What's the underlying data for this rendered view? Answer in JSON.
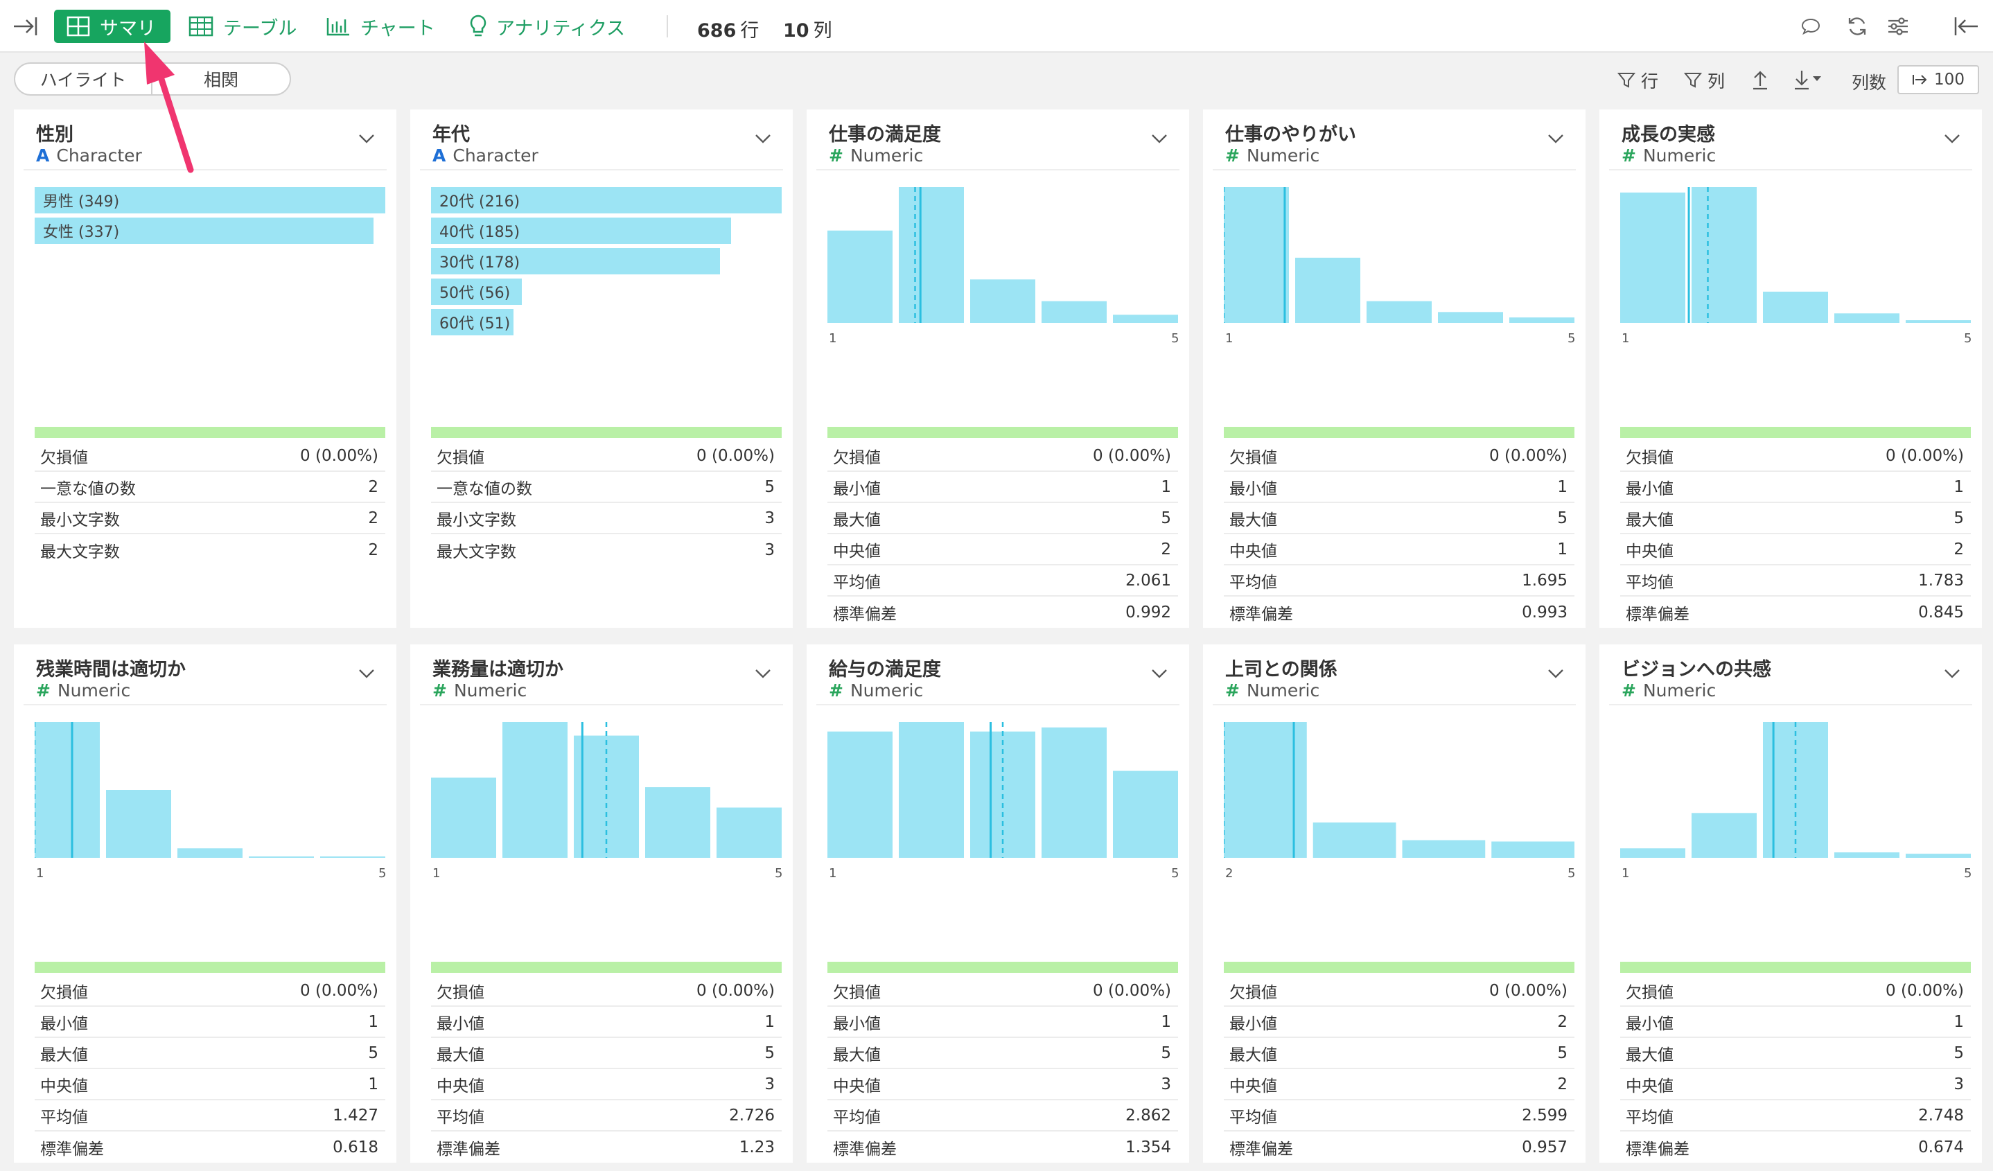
{
  "toolbar": {
    "tabs": [
      {
        "label": "サマリ",
        "icon": "grid-icon"
      },
      {
        "label": "テーブル",
        "icon": "table-icon"
      },
      {
        "label": "チャート",
        "icon": "bar-chart-icon"
      },
      {
        "label": "アナリティクス",
        "icon": "lightbulb-icon"
      }
    ],
    "rows_count": "686",
    "rows_unit": "行",
    "cols_count": "10",
    "cols_unit": "列"
  },
  "subbar": {
    "segments": [
      "ハイライト",
      "相関"
    ],
    "filter_row": "行",
    "filter_col": "列",
    "col_count_label": "列数",
    "col_count_value": "100"
  },
  "columns": [
    {
      "title": "性別",
      "type": "Character",
      "kind": "char",
      "bars": [
        {
          "label": "男性 (349)",
          "value": 349
        },
        {
          "label": "女性 (337)",
          "value": 337
        }
      ],
      "stats": [
        {
          "label": "欠損値",
          "value": "0 (0.00%)"
        },
        {
          "label": "一意な値の数",
          "value": "2"
        },
        {
          "label": "最小文字数",
          "value": "2"
        },
        {
          "label": "最大文字数",
          "value": "2"
        }
      ]
    },
    {
      "title": "年代",
      "type": "Character",
      "kind": "char",
      "bars": [
        {
          "label": "20代 (216)",
          "value": 216
        },
        {
          "label": "40代 (185)",
          "value": 185
        },
        {
          "label": "30代 (178)",
          "value": 178
        },
        {
          "label": "50代 (56)",
          "value": 56
        },
        {
          "label": "60代 (51)",
          "value": 51
        }
      ],
      "stats": [
        {
          "label": "欠損値",
          "value": "0 (0.00%)"
        },
        {
          "label": "一意な値の数",
          "value": "5"
        },
        {
          "label": "最小文字数",
          "value": "3"
        },
        {
          "label": "最大文字数",
          "value": "3"
        }
      ]
    },
    {
      "title": "仕事の満足度",
      "type": "Numeric",
      "kind": "num",
      "hist": [
        0.68,
        1.0,
        0.32,
        0.16,
        0.06
      ],
      "axis_min": "1",
      "axis_max": "5",
      "mean": 2.061,
      "median": 2,
      "stats": [
        {
          "label": "欠損値",
          "value": "0 (0.00%)"
        },
        {
          "label": "最小値",
          "value": "1"
        },
        {
          "label": "最大値",
          "value": "5"
        },
        {
          "label": "中央値",
          "value": "2"
        },
        {
          "label": "平均値",
          "value": "2.061"
        },
        {
          "label": "標準偏差",
          "value": "0.992"
        }
      ]
    },
    {
      "title": "仕事のやりがい",
      "type": "Numeric",
      "kind": "num",
      "hist": [
        1.0,
        0.48,
        0.16,
        0.08,
        0.04
      ],
      "axis_min": "1",
      "axis_max": "5",
      "mean": 1.695,
      "median": 1,
      "stats": [
        {
          "label": "欠損値",
          "value": "0 (0.00%)"
        },
        {
          "label": "最小値",
          "value": "1"
        },
        {
          "label": "最大値",
          "value": "5"
        },
        {
          "label": "中央値",
          "value": "1"
        },
        {
          "label": "平均値",
          "value": "1.695"
        },
        {
          "label": "標準偏差",
          "value": "0.993"
        }
      ]
    },
    {
      "title": "成長の実感",
      "type": "Numeric",
      "kind": "num",
      "hist": [
        0.96,
        1.0,
        0.23,
        0.07,
        0.02
      ],
      "axis_min": "1",
      "axis_max": "5",
      "mean": 1.783,
      "median": 2,
      "stats": [
        {
          "label": "欠損値",
          "value": "0 (0.00%)"
        },
        {
          "label": "最小値",
          "value": "1"
        },
        {
          "label": "最大値",
          "value": "5"
        },
        {
          "label": "中央値",
          "value": "2"
        },
        {
          "label": "平均値",
          "value": "1.783"
        },
        {
          "label": "標準偏差",
          "value": "0.845"
        }
      ]
    },
    {
      "title": "残業時間は適切か",
      "type": "Numeric",
      "kind": "num",
      "hist": [
        1.0,
        0.5,
        0.07,
        0.01,
        0.01
      ],
      "axis_min": "1",
      "axis_max": "5",
      "mean": 1.427,
      "median": 1,
      "stats": [
        {
          "label": "欠損値",
          "value": "0 (0.00%)"
        },
        {
          "label": "最小値",
          "value": "1"
        },
        {
          "label": "最大値",
          "value": "5"
        },
        {
          "label": "中央値",
          "value": "1"
        },
        {
          "label": "平均値",
          "value": "1.427"
        },
        {
          "label": "標準偏差",
          "value": "0.618"
        }
      ]
    },
    {
      "title": "業務量は適切か",
      "type": "Numeric",
      "kind": "num",
      "hist": [
        0.59,
        1.0,
        0.9,
        0.52,
        0.37
      ],
      "axis_min": "1",
      "axis_max": "5",
      "mean": 2.726,
      "median": 3,
      "stats": [
        {
          "label": "欠損値",
          "value": "0 (0.00%)"
        },
        {
          "label": "最小値",
          "value": "1"
        },
        {
          "label": "最大値",
          "value": "5"
        },
        {
          "label": "中央値",
          "value": "3"
        },
        {
          "label": "平均値",
          "value": "2.726"
        },
        {
          "label": "標準偏差",
          "value": "1.23"
        }
      ]
    },
    {
      "title": "給与の満足度",
      "type": "Numeric",
      "kind": "num",
      "hist": [
        0.93,
        1.0,
        0.93,
        0.96,
        0.64
      ],
      "axis_min": "1",
      "axis_max": "5",
      "mean": 2.862,
      "median": 3,
      "stats": [
        {
          "label": "欠損値",
          "value": "0 (0.00%)"
        },
        {
          "label": "最小値",
          "value": "1"
        },
        {
          "label": "最大値",
          "value": "5"
        },
        {
          "label": "中央値",
          "value": "3"
        },
        {
          "label": "平均値",
          "value": "2.862"
        },
        {
          "label": "標準偏差",
          "value": "1.354"
        }
      ]
    },
    {
      "title": "上司との関係",
      "type": "Numeric",
      "kind": "num",
      "hist": [
        1.0,
        0.26,
        0.13,
        0.12
      ],
      "axis_min": "2",
      "axis_max": "5",
      "mean": 2.599,
      "median": 2,
      "stats": [
        {
          "label": "欠損値",
          "value": "0 (0.00%)"
        },
        {
          "label": "最小値",
          "value": "2"
        },
        {
          "label": "最大値",
          "value": "5"
        },
        {
          "label": "中央値",
          "value": "2"
        },
        {
          "label": "平均値",
          "value": "2.599"
        },
        {
          "label": "標準偏差",
          "value": "0.957"
        }
      ]
    },
    {
      "title": "ビジョンへの共感",
      "type": "Numeric",
      "kind": "num",
      "hist": [
        0.07,
        0.33,
        1.0,
        0.04,
        0.03
      ],
      "axis_min": "1",
      "axis_max": "5",
      "mean": 2.748,
      "median": 3,
      "stats": [
        {
          "label": "欠損値",
          "value": "0 (0.00%)"
        },
        {
          "label": "最小値",
          "value": "1"
        },
        {
          "label": "最大値",
          "value": "5"
        },
        {
          "label": "中央値",
          "value": "3"
        },
        {
          "label": "平均値",
          "value": "2.748"
        },
        {
          "label": "標準偏差",
          "value": "0.674"
        }
      ]
    }
  ],
  "colors": {
    "accent": "#17a55f",
    "bar": "#9ce4f4",
    "mean_line": "#2bbfe0",
    "quality": "#b9f0a6",
    "arrow": "#f0356f"
  }
}
